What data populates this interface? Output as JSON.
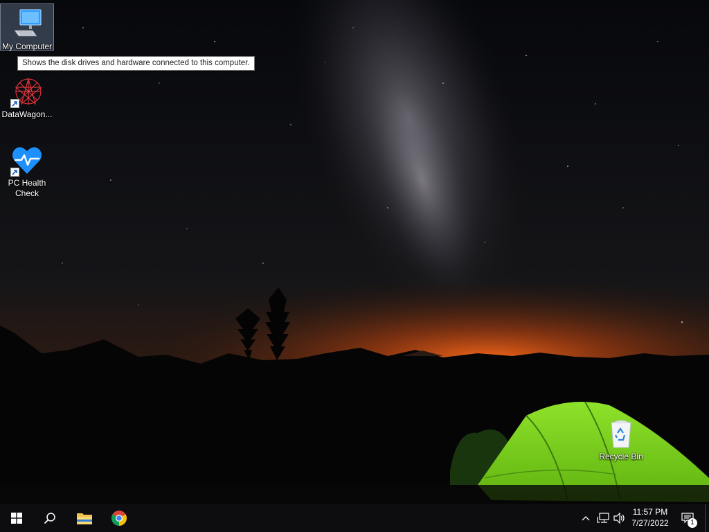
{
  "desktop": {
    "icons": [
      {
        "label": "My Computer",
        "selected": true
      },
      {
        "label": "DataWagon..."
      },
      {
        "label": "PC Health Check"
      },
      {
        "label": "Recycle Bin"
      }
    ],
    "tooltip": "Shows the disk drives and hardware connected to this computer."
  },
  "taskbar": {
    "pinned": [
      "start-icon",
      "search-icon",
      "file-explorer-icon",
      "chrome-icon"
    ],
    "clock": {
      "time": "11:57 PM",
      "date": "7/27/2022"
    },
    "notification_count": "1"
  },
  "colors": {
    "taskbar": "#0d0d10",
    "sky_top": "#0a0b10",
    "horizon_glow": "#e0561a",
    "tent": "#7ed321",
    "windows_blue": "#1e90ff"
  }
}
